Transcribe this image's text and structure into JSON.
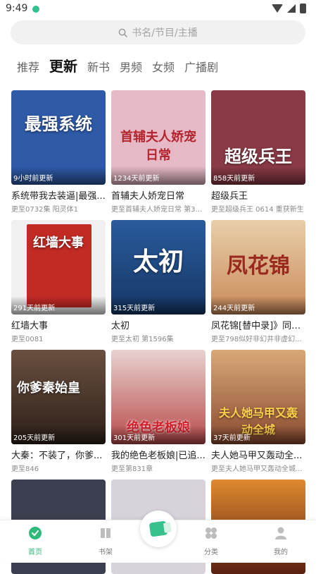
{
  "status": {
    "time": "9:49"
  },
  "search": {
    "placeholder": "书名/节目/主播"
  },
  "tabs": [
    {
      "label": "推荐",
      "active": false
    },
    {
      "label": "更新",
      "active": true
    },
    {
      "label": "新书",
      "active": false
    },
    {
      "label": "男频",
      "active": false
    },
    {
      "label": "女频",
      "active": false
    },
    {
      "label": "广播剧",
      "active": false
    }
  ],
  "books": [
    {
      "title": "系统带我去装逼|最强...",
      "subtitle": "更至0732集 阳灵体1",
      "update": "9小时前更新",
      "cover_text": "最强系统",
      "cover_bg": "#2f5aa8"
    },
    {
      "title": "首辅夫人娇宠日常",
      "subtitle": "更至首辅夫人娇宠日常 第38...",
      "update": "1234天前更新",
      "cover_text": "首辅夫人娇宠日常",
      "cover_bg": "#e6b9c6"
    },
    {
      "title": "超级兵王",
      "subtitle": "更至超级兵王 0614 重获新生",
      "update": "858天前更新",
      "cover_text": "超级兵王",
      "cover_bg": "#8a3a46"
    },
    {
      "title": "红墙大事",
      "subtitle": "更至0081",
      "update": "291天前更新",
      "cover_text": "红墙大事",
      "cover_bg": "#c22a24"
    },
    {
      "title": "太初",
      "subtitle": "更至太初 第1596集",
      "update": "315天前更新",
      "cover_text": "太初",
      "cover_bg": "#1f4d8a"
    },
    {
      "title": "凤花锦[替中录]》同款...",
      "subtitle": "更至798似好非幻井非虚幻...",
      "update": "244天前更新",
      "cover_text": "凤花锦",
      "cover_bg": "#d9b08a"
    },
    {
      "title": "大秦：不装了，你爹...",
      "subtitle": "更至846",
      "update": "205天前更新",
      "cover_text": "你爹秦始皇",
      "cover_bg": "#5a4130"
    },
    {
      "title": "我的绝色老板娘|已追...",
      "subtitle": "更至第831章",
      "update": "301天前更新",
      "cover_text": "绝色老板娘",
      "cover_bg": "#b84a4a"
    },
    {
      "title": "夫人她马甲又轰动全...",
      "subtitle": "更至夫人她马甲又轰动全城...",
      "update": "37天前更新",
      "cover_text": "夫人她马甲又轰动全城",
      "cover_bg": "#b8744a"
    },
    {
      "title": "",
      "subtitle": "",
      "update": "",
      "cover_text": "",
      "cover_bg": "#3b3f4f"
    },
    {
      "title": "",
      "subtitle": "",
      "update": "",
      "cover_text": "",
      "cover_bg": "#d8d2da"
    },
    {
      "title": "",
      "subtitle": "",
      "update": "",
      "cover_text": "",
      "cover_bg": "#7a3a20"
    }
  ],
  "nav": [
    {
      "label": "首页",
      "icon": "home-icon",
      "active": true
    },
    {
      "label": "书架",
      "icon": "bookshelf-icon",
      "active": false
    },
    {
      "label": "分类",
      "icon": "category-icon",
      "active": false
    },
    {
      "label": "我的",
      "icon": "profile-icon",
      "active": false
    }
  ],
  "colors": {
    "accent": "#2fba7a"
  }
}
